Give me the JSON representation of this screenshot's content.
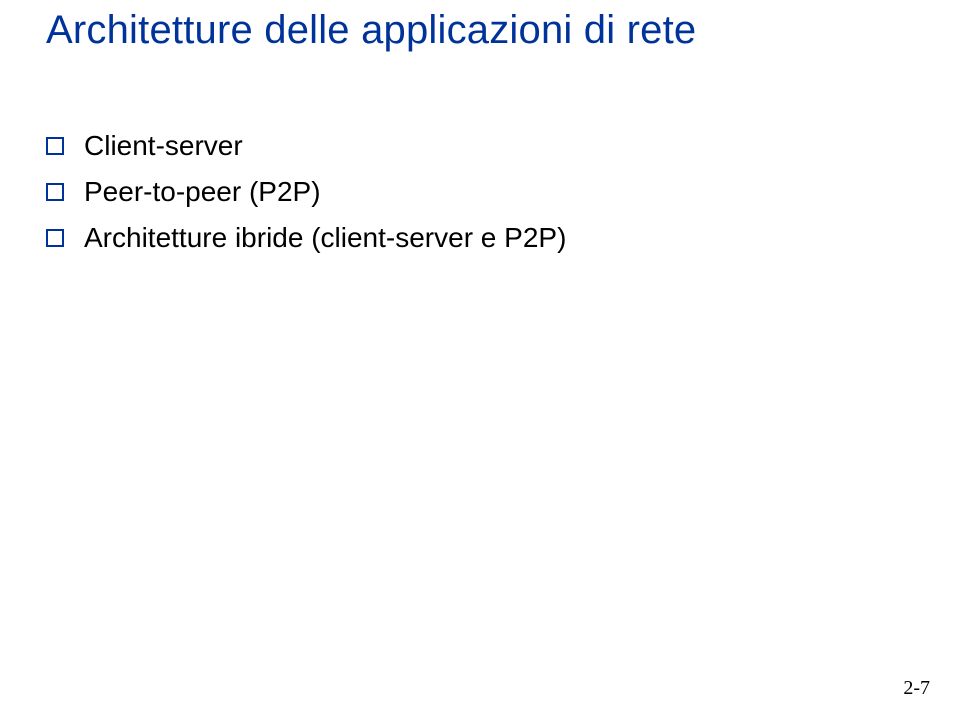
{
  "title": "Architetture delle applicazioni di rete",
  "bullets": [
    {
      "text": "Client-server"
    },
    {
      "text": "Peer-to-peer (P2P)"
    },
    {
      "text": "Architetture ibride (client-server e P2P)"
    }
  ],
  "page_number": "2-7"
}
